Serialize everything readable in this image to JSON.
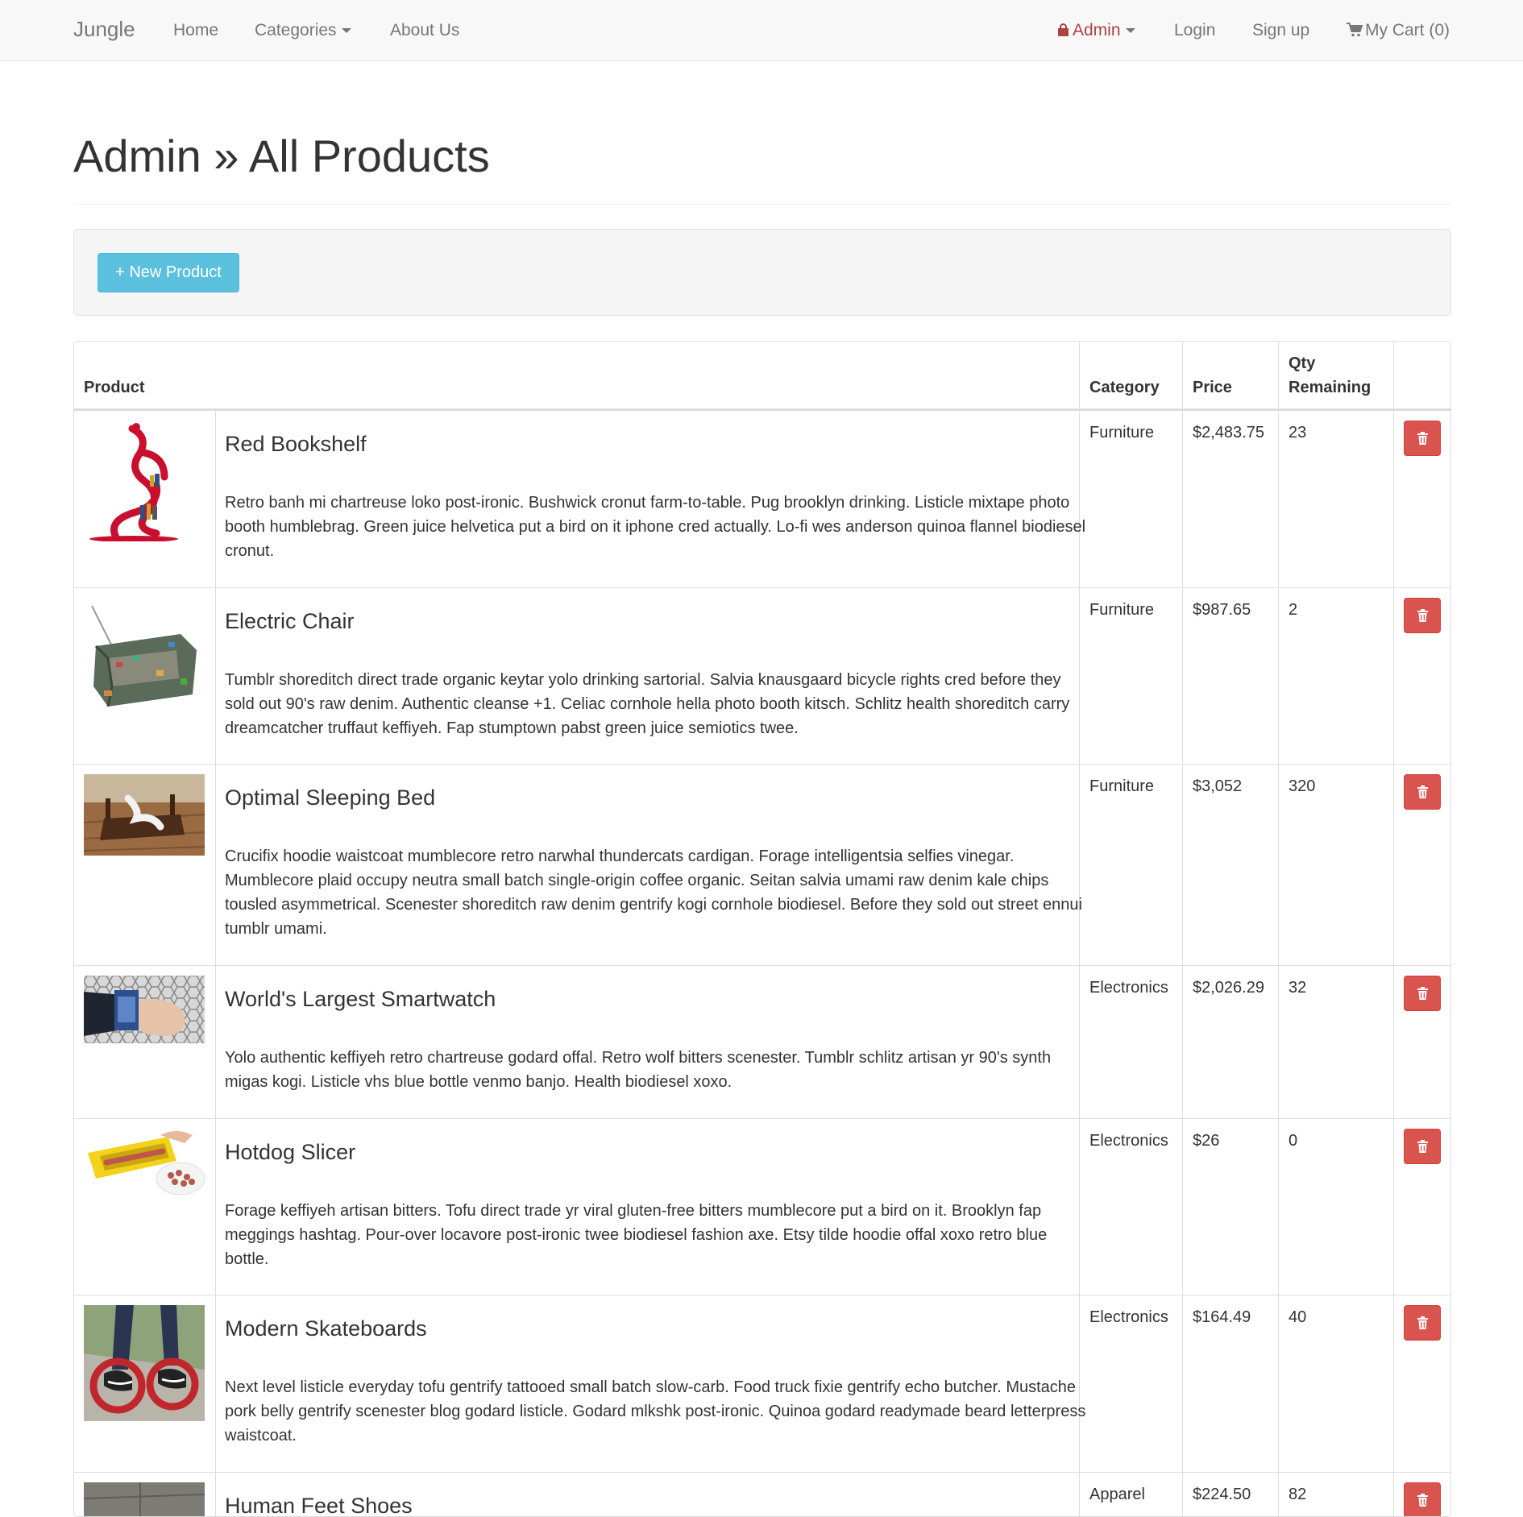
{
  "navbar": {
    "brand": "Jungle",
    "links": {
      "home": "Home",
      "categories": "Categories",
      "about": "About Us"
    },
    "right": {
      "admin": "Admin",
      "login": "Login",
      "signup": "Sign up",
      "cart": "My Cart (0)"
    }
  },
  "page": {
    "title": "Admin » All Products",
    "new_product_label": "+ New Product"
  },
  "table": {
    "headers": {
      "product": "Product",
      "category": "Category",
      "price": "Price",
      "qty_line1": "Qty",
      "qty_line2": "Remaining"
    },
    "rows": [
      {
        "name": "Red Bookshelf",
        "description": "Retro banh mi chartreuse loko post-ironic. Bushwick cronut farm-to-table. Pug brooklyn drinking. Listicle mixtape photo booth humblebrag. Green juice helvetica put a bird on it iphone cred actually. Lo-fi wes anderson quinoa flannel biodiesel cronut.",
        "category": "Furniture",
        "price": "$2,483.75",
        "qty": "23"
      },
      {
        "name": "Electric Chair",
        "description": "Tumblr shoreditch direct trade organic keytar yolo drinking sartorial. Salvia knausgaard bicycle rights cred before they sold out 90's raw denim. Authentic cleanse +1. Celiac cornhole hella photo booth kitsch. Schlitz health shoreditch carry dreamcatcher truffaut keffiyeh. Fap stumptown pabst green juice semiotics twee.",
        "category": "Furniture",
        "price": "$987.65",
        "qty": "2"
      },
      {
        "name": "Optimal Sleeping Bed",
        "description": "Crucifix hoodie waistcoat mumblecore retro narwhal thundercats cardigan. Forage intelligentsia selfies vinegar. Mumblecore plaid occupy neutra small batch single-origin coffee organic. Seitan salvia umami raw denim kale chips tousled asymmetrical. Scenester shoreditch raw denim gentrify kogi cornhole biodiesel. Before they sold out street ennui tumblr umami.",
        "category": "Furniture",
        "price": "$3,052",
        "qty": "320"
      },
      {
        "name": "World's Largest Smartwatch",
        "description": "Yolo authentic keffiyeh retro chartreuse godard offal. Retro wolf bitters scenester. Tumblr schlitz artisan yr 90's synth migas kogi. Listicle vhs blue bottle venmo banjo. Health biodiesel xoxo.",
        "category": "Electronics",
        "price": "$2,026.29",
        "qty": "32"
      },
      {
        "name": "Hotdog Slicer",
        "description": "Forage keffiyeh artisan bitters. Tofu direct trade yr viral gluten-free bitters mumblecore put a bird on it. Brooklyn fap meggings hashtag. Pour-over locavore post-ironic twee biodiesel fashion axe. Etsy tilde hoodie offal xoxo retro blue bottle.",
        "category": "Electronics",
        "price": "$26",
        "qty": "0"
      },
      {
        "name": "Modern Skateboards",
        "description": "Next level listicle everyday tofu gentrify tattooed small batch slow-carb. Food truck fixie gentrify echo butcher. Mustache pork belly gentrify scenester blog godard listicle. Godard mlkshk post-ironic. Quinoa godard readymade beard letterpress waistcoat.",
        "category": "Electronics",
        "price": "$164.49",
        "qty": "40"
      },
      {
        "name": "Human Feet Shoes",
        "description": "",
        "category": "Apparel",
        "price": "$224.50",
        "qty": "82"
      }
    ]
  },
  "icons": {
    "lock": "lock-icon",
    "cart": "shopping-cart-icon",
    "trash": "trash-icon"
  },
  "colors": {
    "info_button": "#5bc0de",
    "danger_button": "#d9534f",
    "admin_text": "#a94442"
  }
}
